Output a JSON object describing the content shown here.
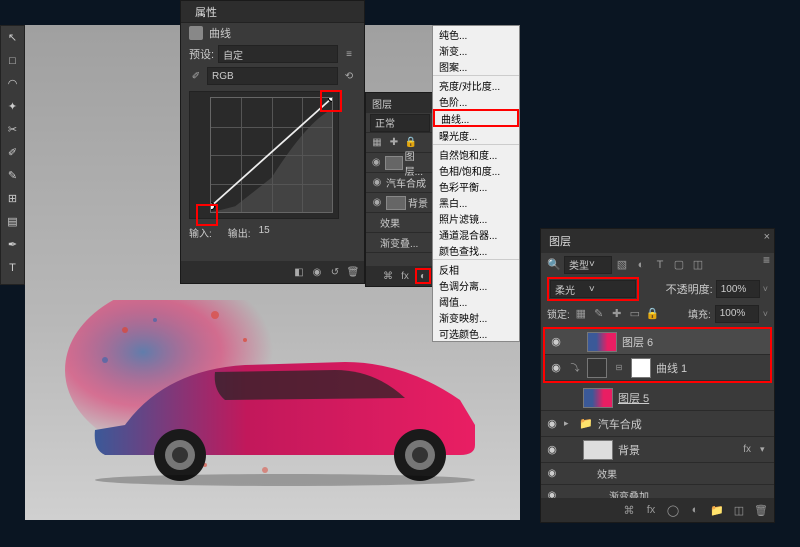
{
  "toolbar": {
    "tools": [
      "↖",
      "□",
      "✎",
      "✂",
      "✏",
      "▲",
      "◆",
      "↗",
      "○",
      "⌂",
      "⊞",
      "■"
    ]
  },
  "props": {
    "tab": "属性",
    "title": "曲线",
    "preset_label": "预设:",
    "preset_value": "自定",
    "channel": "RGB",
    "input_label": "输入:",
    "input_value": "",
    "output_label": "输出:",
    "output_value": "15"
  },
  "small_layers": {
    "title": "图层",
    "mode": "正常",
    "items": [
      {
        "label": "图层..."
      },
      {
        "label": "汽车合成"
      },
      {
        "label": "背景"
      },
      {
        "label": "效果"
      },
      {
        "label": "渐变叠..."
      }
    ]
  },
  "chart_data": {
    "type": "line",
    "title": "曲线",
    "xlabel": "输入",
    "ylabel": "输出",
    "x": [
      0,
      255
    ],
    "y": [
      15,
      255
    ],
    "xlim": [
      0,
      255
    ],
    "ylim": [
      0,
      255
    ],
    "channel": "RGB"
  },
  "adj_menu": {
    "items": [
      "纯色...",
      "渐变...",
      "图案...",
      "-",
      "亮度/对比度...",
      "色阶...",
      "曲线...",
      "曝光度...",
      "-",
      "自然饱和度...",
      "色相/饱和度...",
      "色彩平衡...",
      "黑白...",
      "照片滤镜...",
      "通道混合器...",
      "颜色查找...",
      "-",
      "反相",
      "色调分离...",
      "阈值...",
      "渐变映射...",
      "可选颜色..."
    ],
    "highlighted": "曲线..."
  },
  "big_layers": {
    "title": "图层",
    "filter_label": "类型",
    "blend_mode": "柔光",
    "opacity_label": "不透明度:",
    "opacity_value": "100%",
    "lock_label": "锁定:",
    "fill_label": "填充:",
    "fill_value": "100%",
    "layers": [
      {
        "name": "图层 6",
        "thumb": "car",
        "eye": true
      },
      {
        "name": "曲线 1",
        "thumb": "curves",
        "eye": true,
        "link": true,
        "mask": true
      },
      {
        "name": "图层 5",
        "thumb": "car",
        "eye": false
      },
      {
        "name": "汽车合成",
        "thumb": "folder",
        "eye": true,
        "folder": true
      },
      {
        "name": "背景",
        "thumb": "bg",
        "eye": true,
        "fx": "fx"
      },
      {
        "name": "效果",
        "sub": true,
        "eye": true
      },
      {
        "name": "渐变叠加",
        "sub": true,
        "eye": true
      }
    ]
  }
}
